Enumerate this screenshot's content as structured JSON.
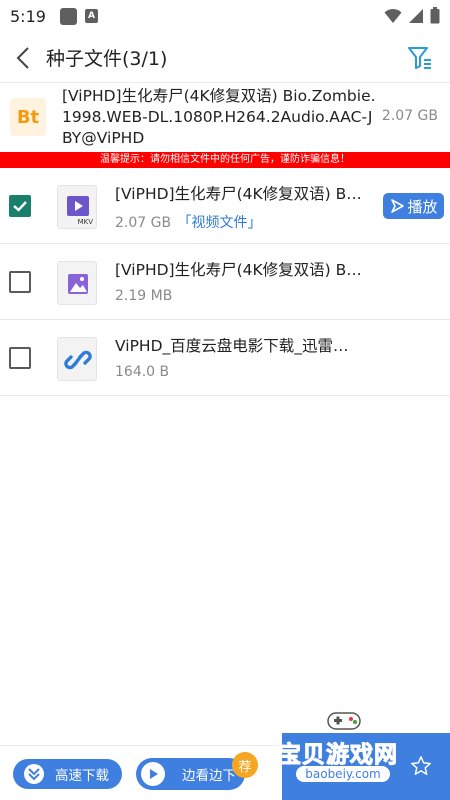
{
  "status_bar": {
    "time": "5:19"
  },
  "header": {
    "title": "种子文件(3/1)"
  },
  "torrent": {
    "icon_text": "Bt",
    "name": "[ViPHD]生化寿尸(4K修复双语) Bio.Zombie.1998.WEB-DL.1080P.H264.2Audio.AAC-JBY@ViPHD",
    "size": "2.07 GB"
  },
  "warning": "温馨提示：请勿相信文件中的任何广告，谨防诈骗信息！",
  "files": [
    {
      "checked": true,
      "icon": "video-file-icon",
      "icon_label": "MKV",
      "name": "[ViPHD]生化寿尸(4K修复双语) B…",
      "size": "2.07 GB",
      "type": "「视频文件」",
      "play_label": "播放"
    },
    {
      "checked": false,
      "icon": "image-file-icon",
      "name": "[ViPHD]生化寿尸(4K修复双语) B…",
      "size": "2.19 MB"
    },
    {
      "checked": false,
      "icon": "link-file-icon",
      "name": "ViPHD_百度云盘电影下载_迅雷…",
      "size": "164.0 B"
    }
  ],
  "bottom": {
    "download_label": "高速下载",
    "stream_label": "边看边下",
    "badge": "荐"
  },
  "watermark": {
    "title": "宝贝游戏网",
    "url": "baobeiy.com"
  },
  "colors": {
    "accent": "#3f7fe0",
    "checkbox": "#1a7f6b",
    "warning_bg": "#ff0000",
    "bt_orange": "#f39a0f"
  }
}
